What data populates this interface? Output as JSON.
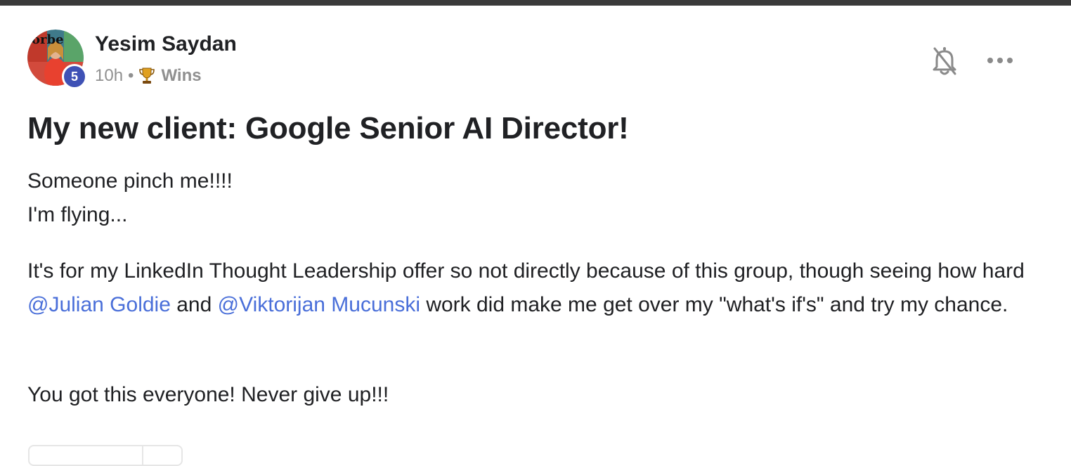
{
  "post": {
    "author": {
      "name": "Yesim Saydan",
      "level": "5",
      "avatar_text": "orbe"
    },
    "time": "10h",
    "separator": "•",
    "category": {
      "icon": "trophy-icon",
      "label": "Wins"
    },
    "actions": {
      "bell_icon": "bell-off-icon",
      "more_icon": "more-horizontal-icon"
    },
    "title": "My new client: Google Senior AI Director!",
    "body": {
      "line1": "Someone pinch me!!!!",
      "line2": "I'm flying...",
      "p2_part1": "It's for my LinkedIn Thought Leadership offer so not directly because of this group, though seeing how hard ",
      "mention1": "@Julian Goldie",
      "p2_part2": " and ",
      "mention2": "@Viktorijan Mucunski",
      "p2_part3": " work did make me get over my \"what's if's\" and try my chance.",
      "p3": "You got this everyone! Never give up!!!"
    }
  },
  "colors": {
    "topbar": "#3a3a3a",
    "badge": "#3f51b5",
    "mention": "#4a6fd9",
    "meta_text": "#909090",
    "icon_gray": "#8a8a8a"
  }
}
